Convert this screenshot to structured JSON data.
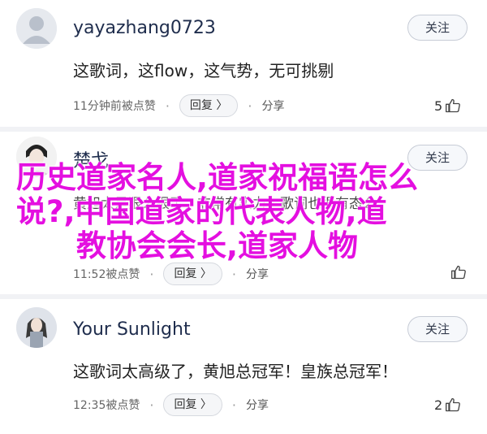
{
  "comments": [
    {
      "username": "yayazhang0723",
      "follow_label": "关注",
      "content": "这歌词，这flow，这气势，无可挑剔",
      "time": "11分钟前被点赞",
      "dot": "·",
      "reply_label": "回复 〉",
      "share_label": "分享",
      "likes": "5",
      "avatar_icon": "default-avatar-icon"
    },
    {
      "username": "楚戈",
      "follow_label": "关注",
      "content": "黄旭太是狠么狠了，非常有实力，歌词也很有态么",
      "time": "11:52被点赞",
      "dot": "·",
      "reply_label": "回复 〉",
      "share_label": "分享",
      "likes": "",
      "avatar_icon": "user-photo-avatar"
    },
    {
      "username": "Your Sunlight",
      "follow_label": "关注",
      "content": "这歌词太高级了，黄旭总冠军！皇族总冠军！",
      "time": "12:35被点赞",
      "dot": "·",
      "reply_label": "回复 〉",
      "share_label": "分享",
      "likes": "2",
      "avatar_icon": "user-photo-avatar"
    }
  ],
  "overlay": {
    "line1": "历史道家名人,道家祝福语怎么",
    "line2": "说?,中国道家的代表人物,道",
    "line3": "教协会会长,道家人物"
  },
  "colors": {
    "overlay_text": "#e40fe0",
    "username": "#1f2d4d",
    "divider": "#f1f2f5"
  }
}
